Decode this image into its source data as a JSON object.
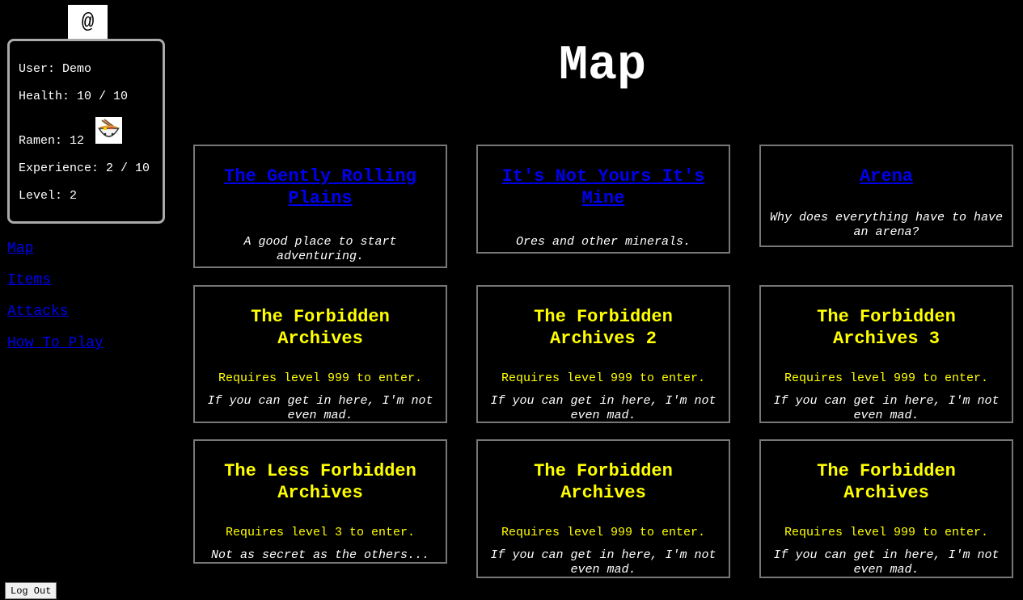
{
  "avatar": {
    "glyph": "@"
  },
  "stats": {
    "user": "User: Demo",
    "health": "Health: 10 / 10",
    "ramen": "Ramen: 12",
    "ramen_icon": "ramen-bowl-icon",
    "experience": "Experience: 2 / 10",
    "level": "Level: 2"
  },
  "nav": [
    {
      "label": "Map"
    },
    {
      "label": "Items"
    },
    {
      "label": "Attacks"
    },
    {
      "label": "How To Play"
    }
  ],
  "page_title": "Map",
  "locations": [
    {
      "title": "The Gently Rolling Plains",
      "description": "A good place to start adventuring."
    },
    {
      "title": "It's Not Yours It's Mine",
      "description": "Ores and other minerals."
    },
    {
      "title": "Arena",
      "description": "Why does everything have to have an arena?"
    },
    {
      "title": "The Forbidden Archives",
      "requirement": "Requires level 999 to enter.",
      "description": "If you can get in here, I'm not even mad."
    },
    {
      "title": "The Forbidden Archives 2",
      "requirement": "Requires level 999 to enter.",
      "description": "If you can get in here, I'm not even mad."
    },
    {
      "title": "The Forbidden Archives 3",
      "requirement": "Requires level 999 to enter.",
      "description": "If you can get in here, I'm not even mad."
    },
    {
      "title": "The Less Forbidden Archives",
      "requirement": "Requires level 3 to enter.",
      "description": "Not as secret as the others..."
    },
    {
      "title": "The Forbidden Archives",
      "requirement": "Requires level 999 to enter.",
      "description": "If you can get in here, I'm not even mad."
    },
    {
      "title": "The Forbidden Archives",
      "requirement": "Requires level 999 to enter.",
      "description": "If you can get in here, I'm not even mad."
    }
  ],
  "logout_label": "Log Out",
  "colors": {
    "background": "#000000",
    "link": "#0000ee",
    "locked_title": "#ffff00",
    "card_border": "#777777"
  }
}
